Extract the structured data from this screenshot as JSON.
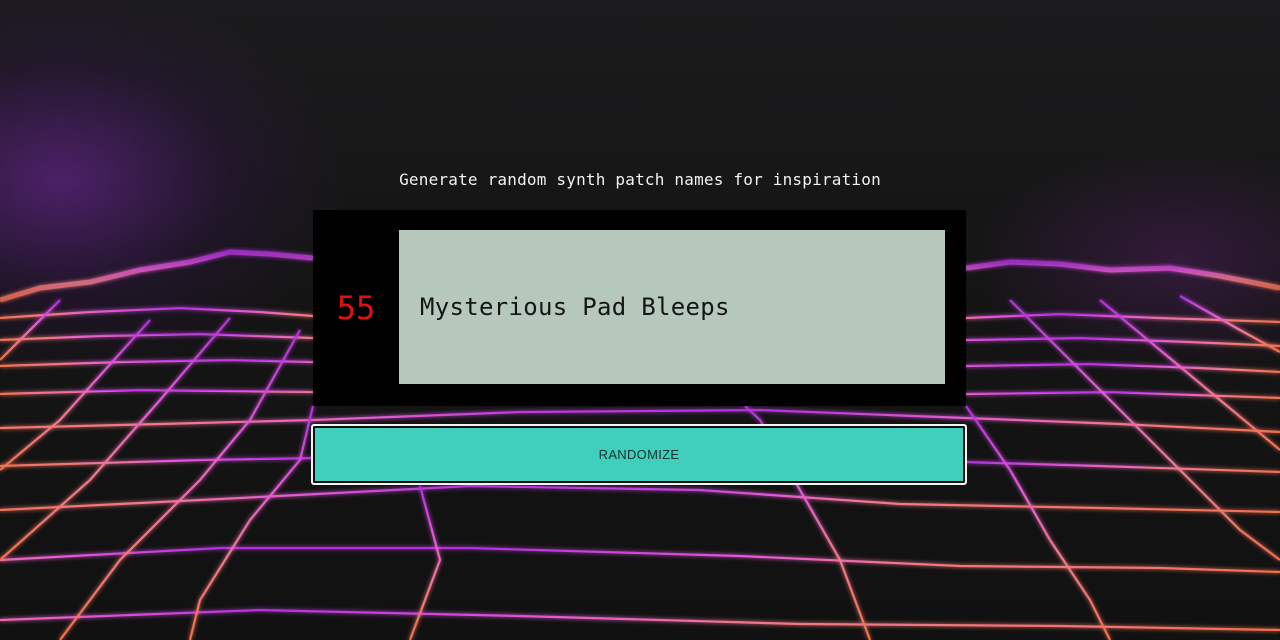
{
  "header": {
    "tagline": "Generate random synth patch names for inspiration"
  },
  "display": {
    "count": "55",
    "patch_name": "Mysterious Pad Bleeps"
  },
  "controls": {
    "randomize_label": "RANDOMIZE"
  },
  "colors": {
    "background": "#151515",
    "grid_near": "#f07a5a",
    "grid_far": "#c040e0",
    "counter_red": "#e01010",
    "screen_green": "#b6c8bc",
    "button_teal": "#41cfbd"
  }
}
